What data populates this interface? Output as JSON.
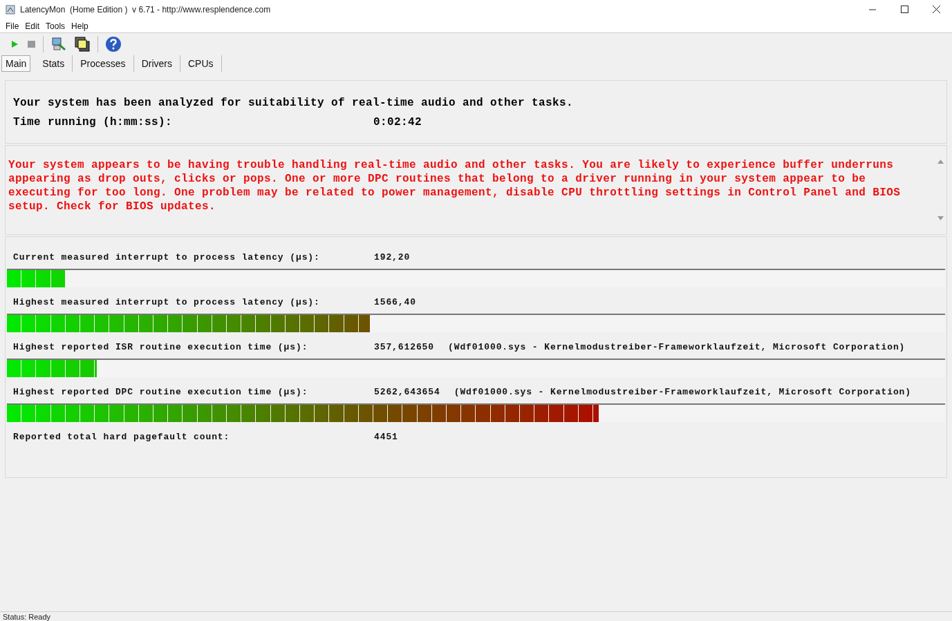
{
  "window": {
    "title": "LatencyMon  (Home Edition )  v 6.71 - http://www.resplendence.com"
  },
  "menu": [
    "File",
    "Edit",
    "Tools",
    "Help"
  ],
  "tabs": [
    {
      "label": "Main",
      "selected": true
    },
    {
      "label": "Stats",
      "selected": false
    },
    {
      "label": "Processes",
      "selected": false
    },
    {
      "label": "Drivers",
      "selected": false
    },
    {
      "label": "CPUs",
      "selected": false
    }
  ],
  "summary": {
    "headline": "Your system has been analyzed for suitability of real-time audio and other tasks.",
    "time_label": "Time running (h:mm:ss):",
    "time_value": "0:02:42"
  },
  "verdict": "Your system appears to be having trouble handling real-time audio and other tasks. You are likely to experience buffer underruns appearing as drop outs, clicks or pops. One or more DPC routines that belong to a driver running in your system appear to be executing for too long. One problem may be related to power management, disable CPU throttling settings in Control Panel and BIOS setup. Check for BIOS updates.",
  "metrics": [
    {
      "label": "Current measured interrupt to process latency (µs):",
      "value": "192,20",
      "level": 0.062
    },
    {
      "label": "Highest measured interrupt to process latency (µs):",
      "value": "1566,40",
      "level": 0.387
    },
    {
      "label": "Highest reported ISR routine execution time (µs):",
      "value": "357,612650",
      "detail": "(Wdf01000.sys - Kernelmodustreiber-Frameworklaufzeit, Microsoft Corporation)",
      "level": 0.096
    },
    {
      "label": "Highest reported DPC routine execution time (µs):",
      "value": "5262,643654",
      "detail": "(Wdf01000.sys - Kernelmodustreiber-Frameworklaufzeit, Microsoft Corporation)",
      "level": 0.631
    },
    {
      "label": "Reported total hard pagefault count:",
      "value": "4451"
    }
  ],
  "status_bar": "Status: Ready"
}
